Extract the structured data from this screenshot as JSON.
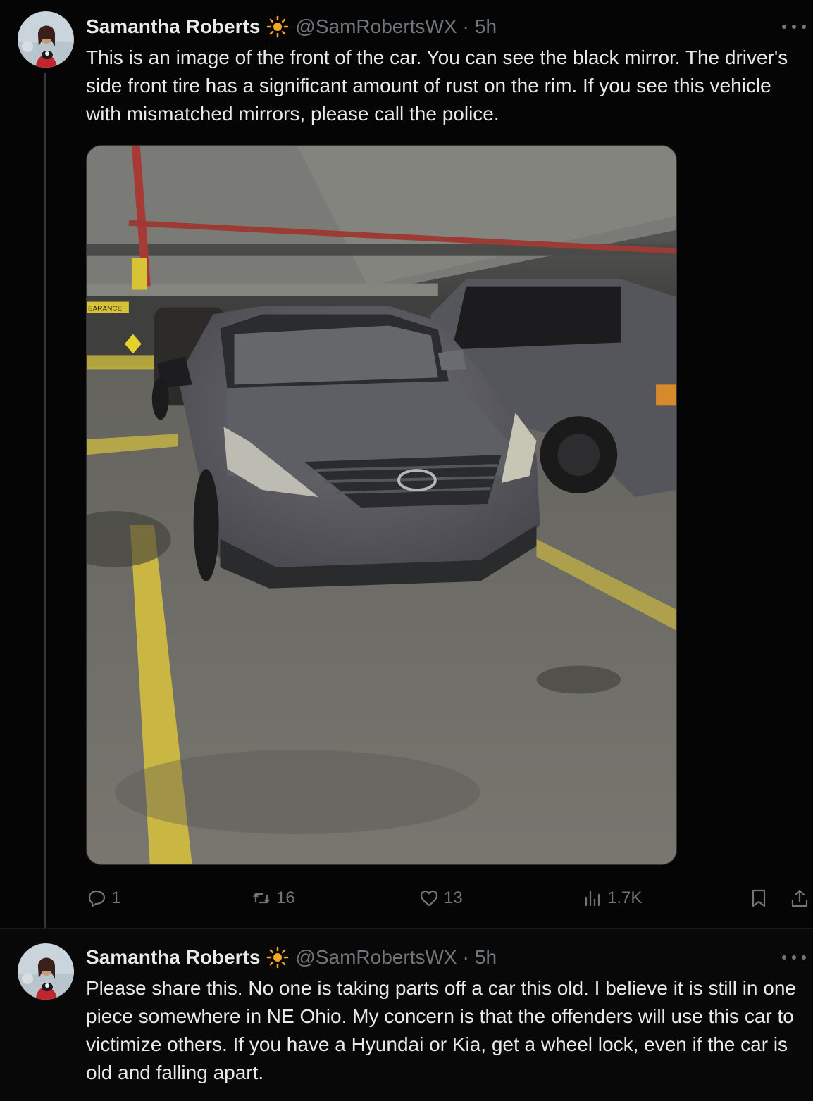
{
  "posts": [
    {
      "author_name": "Samantha Roberts",
      "handle": "@SamRobertsWX",
      "separator": "·",
      "time": "5h",
      "text": "This is an image of the front of the car. You can see the black mirror. The driver's side front tire has a significant amount of rust on the rim. If you see this vehicle with mismatched mirrors, please call the police.",
      "media": {
        "sign_text": "EARANCE",
        "icon": "photo-of-gray-hyundai-sedan-in-parking-garage"
      },
      "actions": {
        "replies": "1",
        "reposts": "16",
        "likes": "13",
        "views": "1.7K"
      }
    },
    {
      "author_name": "Samantha Roberts",
      "handle": "@SamRobertsWX",
      "separator": "·",
      "time": "5h",
      "text": "Please share this. No one is taking parts off a car this old. I believe it is still in one piece somewhere in NE Ohio. My concern is that the offenders will use this car to victimize others. If you have a Hyundai or Kia, get a wheel lock, even if the car is old and falling apart."
    }
  ],
  "icons": {
    "badge": "sun-icon",
    "more": "more-icon",
    "reply": "reply-icon",
    "repost": "repost-icon",
    "like": "heart-icon",
    "views": "views-icon",
    "bookmark": "bookmark-icon",
    "share": "share-icon"
  },
  "colors": {
    "background": "#000000",
    "text_primary": "#e7e9ea",
    "text_secondary": "#71767b",
    "badge_sun": "#f5a623"
  }
}
